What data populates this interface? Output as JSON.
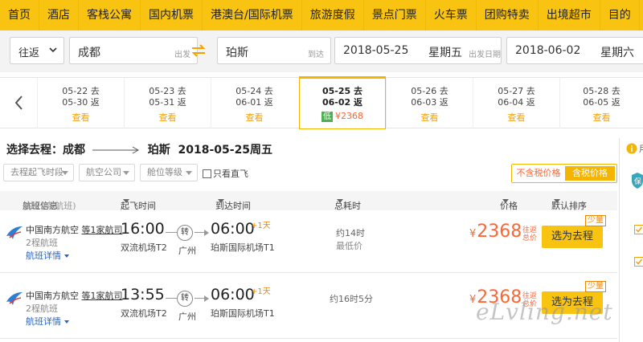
{
  "nav": {
    "items": [
      "首页",
      "酒店",
      "客栈公寓",
      "国内机票",
      "港澳台/国际机票",
      "旅游度假",
      "景点门票",
      "火车票",
      "团购特卖",
      "出境超市",
      "目的"
    ]
  },
  "search": {
    "trip_type": "往返",
    "from_city": "成都",
    "from_hint": "出发",
    "to_city": "珀斯",
    "to_hint": "到达",
    "depart_date": "2018-05-25",
    "depart_weekday": "星期五",
    "depart_hint": "出发日期",
    "return_date": "2018-06-02",
    "return_weekday": "星期六"
  },
  "date_strip": {
    "cells": [
      {
        "go": "05-22 去",
        "back": "05-30 返",
        "price": "查看"
      },
      {
        "go": "05-23 去",
        "back": "05-31 返",
        "price": "查看"
      },
      {
        "go": "05-24 去",
        "back": "06-01 返",
        "price": "查看"
      },
      {
        "go": "05-25 去",
        "back": "06-02 返",
        "badge": "低",
        "price": "¥2368"
      },
      {
        "go": "05-26 去",
        "back": "06-03 返",
        "price": "查看"
      },
      {
        "go": "05-27 去",
        "back": "06-04 返",
        "price": "查看"
      },
      {
        "go": "05-28 去",
        "back": "06-05 返",
        "price": "查看"
      }
    ]
  },
  "route": {
    "label": "选择去程：",
    "from": "成都",
    "to": "珀斯",
    "date": "2018-05-25周五"
  },
  "right_panel": {
    "text": "用"
  },
  "filters": {
    "time": "去程起飞时段",
    "airline": "航空公司",
    "cabin": "舱位等级",
    "direct": "只看直飞",
    "tax_off": "不含税价格",
    "tax_on": "含税价格"
  },
  "table_header": {
    "flight_info": "航班信息",
    "count": "(共22条航班)",
    "depart_time": "起飞时间",
    "arrive_time": "到达时间",
    "duration": "总耗时",
    "price": "价格",
    "sort": "默认排序"
  },
  "flights": [
    {
      "airline": "中国南方航空",
      "share": "等1家航司",
      "sub": "2程航班",
      "detail": "航班详情",
      "dep_time": "16:00",
      "dep_airport": "双流机场T2",
      "transfer": "转",
      "stop": "广州",
      "arr_time": "06:00",
      "plus": "+1天",
      "arr_airport": "珀斯国际机场T1",
      "duration": "约14时",
      "lowest": "最低价",
      "currency": "¥",
      "price": "2368",
      "note": "往返总价",
      "book": "选为去程",
      "few": "少量"
    },
    {
      "airline": "中国南方航空",
      "share": "等1家航司",
      "sub": "2程航班",
      "detail": "航班详情",
      "dep_time": "13:55",
      "dep_airport": "双流机场T2",
      "transfer": "转",
      "stop": "广州",
      "arr_time": "06:00",
      "plus": "+1天",
      "arr_airport": "珀斯国际机场T1",
      "duration": "约16时5分",
      "lowest": "",
      "currency": "¥",
      "price": "2368",
      "note": "往返总价",
      "book": "选为去程",
      "few": "少量"
    }
  ],
  "watermark": "eLvling.net",
  "colors": {
    "brand": "#f8c411",
    "price": "#ff6633",
    "link": "#2266cc"
  }
}
